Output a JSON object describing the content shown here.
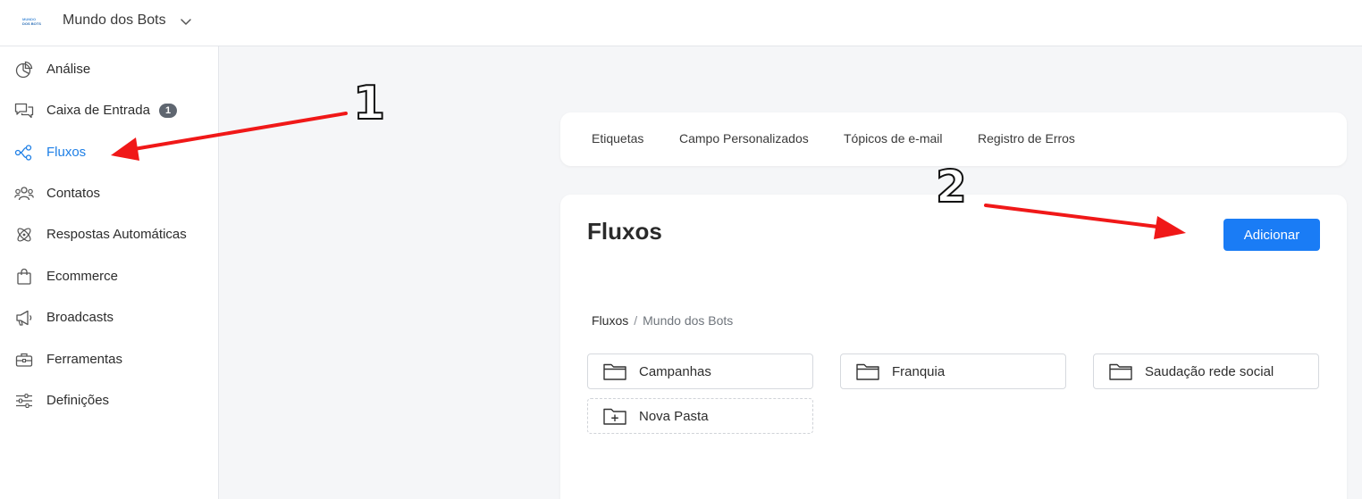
{
  "header": {
    "logo": {
      "line1": "MUNDO",
      "line2": "DOS BOTS"
    },
    "workspace_name": "Mundo dos Bots",
    "icons": {
      "dropdown": "chevron-down-icon"
    }
  },
  "sidebar": {
    "items": [
      {
        "label": "Análise",
        "icon": "pie-chart-icon"
      },
      {
        "label": "Caixa de Entrada",
        "icon": "chat-bubbles-icon",
        "badge": "1"
      },
      {
        "label": "Fluxos",
        "icon": "flow-nodes-icon",
        "active": true
      },
      {
        "label": "Contatos",
        "icon": "users-icon"
      },
      {
        "label": "Respostas Automáticas",
        "icon": "atom-icon"
      },
      {
        "label": "Ecommerce",
        "icon": "shopping-bag-icon"
      },
      {
        "label": "Broadcasts",
        "icon": "megaphone-icon"
      },
      {
        "label": "Ferramentas",
        "icon": "toolbox-icon"
      },
      {
        "label": "Definições",
        "icon": "sliders-icon"
      }
    ]
  },
  "tabs": [
    {
      "label": "Etiquetas"
    },
    {
      "label": "Campo Personalizados"
    },
    {
      "label": "Tópicos de e-mail"
    },
    {
      "label": "Registro de Erros"
    }
  ],
  "main": {
    "title": "Fluxos",
    "add_button": "Adicionar",
    "breadcrumb": {
      "root": "Fluxos",
      "separator": "/",
      "current": "Mundo dos Bots"
    },
    "folders": [
      {
        "label": "Campanhas",
        "icon": "folder-icon"
      },
      {
        "label": "Franquia",
        "icon": "folder-icon"
      },
      {
        "label": "Saudação rede social",
        "icon": "folder-icon"
      },
      {
        "label": "Nova Pasta",
        "icon": "folder-plus-icon"
      }
    ]
  },
  "annotations": [
    {
      "label": "1",
      "color": "#f01818"
    },
    {
      "label": "2",
      "color": "#f01818"
    }
  ],
  "colors": {
    "accent": "#1a7cf5",
    "active_nav": "#1e7fe6",
    "background": "#f5f6f8",
    "badge": "#5f6670"
  }
}
